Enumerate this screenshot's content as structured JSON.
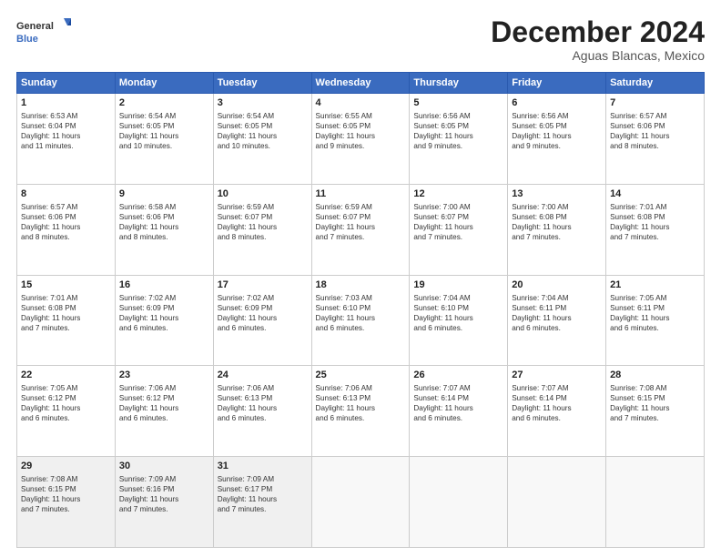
{
  "logo": {
    "line1": "General",
    "line2": "Blue"
  },
  "title": "December 2024",
  "subtitle": "Aguas Blancas, Mexico",
  "days_of_week": [
    "Sunday",
    "Monday",
    "Tuesday",
    "Wednesday",
    "Thursday",
    "Friday",
    "Saturday"
  ],
  "weeks": [
    [
      {
        "day": "1",
        "detail": "Sunrise: 6:53 AM\nSunset: 6:04 PM\nDaylight: 11 hours\nand 11 minutes."
      },
      {
        "day": "2",
        "detail": "Sunrise: 6:54 AM\nSunset: 6:05 PM\nDaylight: 11 hours\nand 10 minutes."
      },
      {
        "day": "3",
        "detail": "Sunrise: 6:54 AM\nSunset: 6:05 PM\nDaylight: 11 hours\nand 10 minutes."
      },
      {
        "day": "4",
        "detail": "Sunrise: 6:55 AM\nSunset: 6:05 PM\nDaylight: 11 hours\nand 9 minutes."
      },
      {
        "day": "5",
        "detail": "Sunrise: 6:56 AM\nSunset: 6:05 PM\nDaylight: 11 hours\nand 9 minutes."
      },
      {
        "day": "6",
        "detail": "Sunrise: 6:56 AM\nSunset: 6:05 PM\nDaylight: 11 hours\nand 9 minutes."
      },
      {
        "day": "7",
        "detail": "Sunrise: 6:57 AM\nSunset: 6:06 PM\nDaylight: 11 hours\nand 8 minutes."
      }
    ],
    [
      {
        "day": "8",
        "detail": "Sunrise: 6:57 AM\nSunset: 6:06 PM\nDaylight: 11 hours\nand 8 minutes."
      },
      {
        "day": "9",
        "detail": "Sunrise: 6:58 AM\nSunset: 6:06 PM\nDaylight: 11 hours\nand 8 minutes."
      },
      {
        "day": "10",
        "detail": "Sunrise: 6:59 AM\nSunset: 6:07 PM\nDaylight: 11 hours\nand 8 minutes."
      },
      {
        "day": "11",
        "detail": "Sunrise: 6:59 AM\nSunset: 6:07 PM\nDaylight: 11 hours\nand 7 minutes."
      },
      {
        "day": "12",
        "detail": "Sunrise: 7:00 AM\nSunset: 6:07 PM\nDaylight: 11 hours\nand 7 minutes."
      },
      {
        "day": "13",
        "detail": "Sunrise: 7:00 AM\nSunset: 6:08 PM\nDaylight: 11 hours\nand 7 minutes."
      },
      {
        "day": "14",
        "detail": "Sunrise: 7:01 AM\nSunset: 6:08 PM\nDaylight: 11 hours\nand 7 minutes."
      }
    ],
    [
      {
        "day": "15",
        "detail": "Sunrise: 7:01 AM\nSunset: 6:08 PM\nDaylight: 11 hours\nand 7 minutes."
      },
      {
        "day": "16",
        "detail": "Sunrise: 7:02 AM\nSunset: 6:09 PM\nDaylight: 11 hours\nand 6 minutes."
      },
      {
        "day": "17",
        "detail": "Sunrise: 7:02 AM\nSunset: 6:09 PM\nDaylight: 11 hours\nand 6 minutes."
      },
      {
        "day": "18",
        "detail": "Sunrise: 7:03 AM\nSunset: 6:10 PM\nDaylight: 11 hours\nand 6 minutes."
      },
      {
        "day": "19",
        "detail": "Sunrise: 7:04 AM\nSunset: 6:10 PM\nDaylight: 11 hours\nand 6 minutes."
      },
      {
        "day": "20",
        "detail": "Sunrise: 7:04 AM\nSunset: 6:11 PM\nDaylight: 11 hours\nand 6 minutes."
      },
      {
        "day": "21",
        "detail": "Sunrise: 7:05 AM\nSunset: 6:11 PM\nDaylight: 11 hours\nand 6 minutes."
      }
    ],
    [
      {
        "day": "22",
        "detail": "Sunrise: 7:05 AM\nSunset: 6:12 PM\nDaylight: 11 hours\nand 6 minutes."
      },
      {
        "day": "23",
        "detail": "Sunrise: 7:06 AM\nSunset: 6:12 PM\nDaylight: 11 hours\nand 6 minutes."
      },
      {
        "day": "24",
        "detail": "Sunrise: 7:06 AM\nSunset: 6:13 PM\nDaylight: 11 hours\nand 6 minutes."
      },
      {
        "day": "25",
        "detail": "Sunrise: 7:06 AM\nSunset: 6:13 PM\nDaylight: 11 hours\nand 6 minutes."
      },
      {
        "day": "26",
        "detail": "Sunrise: 7:07 AM\nSunset: 6:14 PM\nDaylight: 11 hours\nand 6 minutes."
      },
      {
        "day": "27",
        "detail": "Sunrise: 7:07 AM\nSunset: 6:14 PM\nDaylight: 11 hours\nand 6 minutes."
      },
      {
        "day": "28",
        "detail": "Sunrise: 7:08 AM\nSunset: 6:15 PM\nDaylight: 11 hours\nand 7 minutes."
      }
    ],
    [
      {
        "day": "29",
        "detail": "Sunrise: 7:08 AM\nSunset: 6:15 PM\nDaylight: 11 hours\nand 7 minutes."
      },
      {
        "day": "30",
        "detail": "Sunrise: 7:09 AM\nSunset: 6:16 PM\nDaylight: 11 hours\nand 7 minutes."
      },
      {
        "day": "31",
        "detail": "Sunrise: 7:09 AM\nSunset: 6:17 PM\nDaylight: 11 hours\nand 7 minutes."
      },
      {
        "day": "",
        "detail": ""
      },
      {
        "day": "",
        "detail": ""
      },
      {
        "day": "",
        "detail": ""
      },
      {
        "day": "",
        "detail": ""
      }
    ]
  ]
}
